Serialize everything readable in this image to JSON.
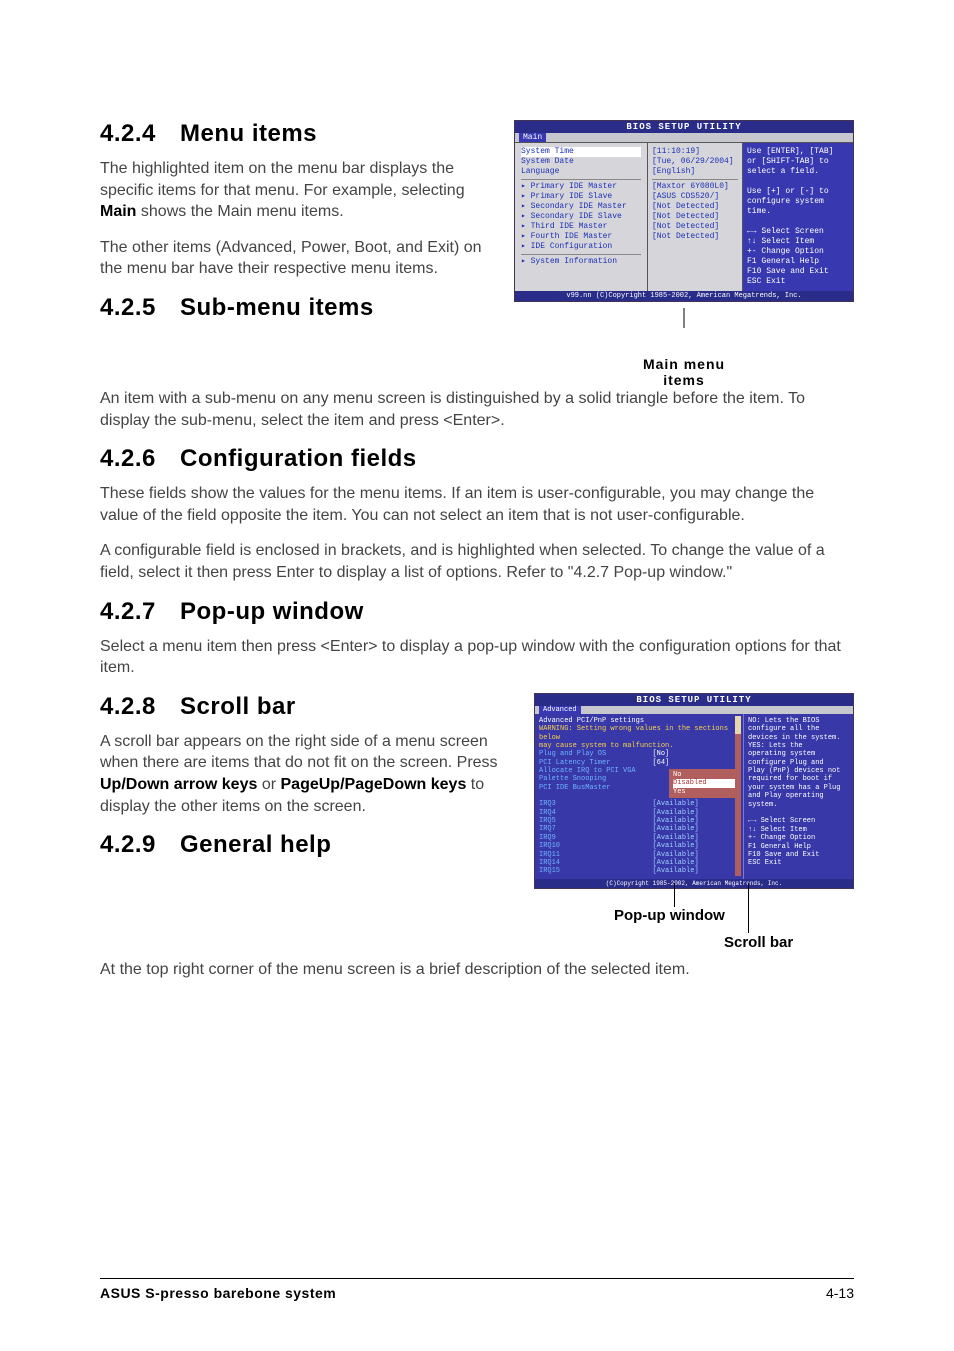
{
  "sections": {
    "s424": {
      "num": "4.2.4",
      "title": "Menu items",
      "p1": "The highlighted item on the menu bar  displays the specific items for that menu. For example, selecting ",
      "p1b": "Main",
      "p1c": " shows the Main menu items.",
      "p2": "The other items (Advanced, Power, Boot, and Exit) on the menu bar have their respective menu items."
    },
    "s425": {
      "num": "4.2.5",
      "title": "Sub-menu items",
      "p1": "An item with a sub-menu on any menu screen is distinguished by a solid triangle before the item. To display the sub-menu, select the item and press <Enter>."
    },
    "s426": {
      "num": "4.2.6",
      "title": "Configuration fields",
      "p1": "These fields show the values for the menu items. If an item is user-configurable, you may change the value of the field opposite the item. You can not select an item that is not user-configurable.",
      "p2": "A configurable field is enclosed in brackets, and is highlighted when selected. To change the value of a field, select it then press Enter to display a list of options. Refer to \"4.2.7 Pop-up window.\""
    },
    "s427": {
      "num": "4.2.7",
      "title": "Pop-up window",
      "p1": "Select a menu item then press <Enter> to display a pop-up window with the configuration options for that item."
    },
    "s428": {
      "num": "4.2.8",
      "title": "Scroll bar",
      "p1a": "A scroll bar appears on the right side of a menu screen when there are items that do not fit on the screen. Press ",
      "p1b": "Up/Down arrow keys",
      "p1c": " or ",
      "p1d": "PageUp/PageDown keys",
      "p1e": " to display the other items on the screen."
    },
    "s429": {
      "num": "4.2.9",
      "title": "General help",
      "p1": "At the top right corner of the menu screen is a brief description of the selected item."
    }
  },
  "bios1": {
    "title": "BIOS SETUP UTILITY",
    "tab": "Main",
    "left": {
      "l1": "System Time",
      "l2": "System Date",
      "l3": "Language",
      "l4": "▸ Primary IDE Master",
      "l5": "▸ Primary IDE Slave",
      "l6": "▸ Secondary IDE Master",
      "l7": "▸ Secondary IDE Slave",
      "l8": "▸ Third IDE Master",
      "l9": "▸ Fourth IDE Master",
      "l10": "▸ IDE Configuration",
      "l11": "▸ System Information"
    },
    "mid": {
      "m1": "[11:10:19]",
      "m2": "[Tue, 06/29/2004]",
      "m3": "[English]",
      "m4": "[Maxtor 6Y080L0]",
      "m5": "[ASUS CDS520/]",
      "m6": "[Not Detected]",
      "m7": "[Not Detected]",
      "m8": "[Not Detected]",
      "m9": "[Not Detected]"
    },
    "right": {
      "r1": "Use [ENTER], [TAB]",
      "r2": "or [SHIFT-TAB] to",
      "r3": "select a field.",
      "r4": "Use [+] or [-] to",
      "r5": "configure system",
      "r6": "time.",
      "r7": "←→   Select Screen",
      "r8": "↑↓   Select Item",
      "r9": "+-   Change Option",
      "r10": "F1   General Help",
      "r11": "F10  Save and Exit",
      "r12": "ESC  Exit"
    },
    "footer": "v99.nn (C)Copyright 1985-2002, American Megatrends, Inc.",
    "caption1": "Main menu",
    "caption2": "items"
  },
  "bios2": {
    "title": "BIOS SETUP UTILITY",
    "tab": "Advanced",
    "head": "Advanced PCI/PnP settings",
    "warn1": "WARNING: Setting wrong values in the sections below",
    "warn2": "         may cause system to malfunction.",
    "r1a": "Plug and Play OS",
    "r1b": "[No]",
    "r2a": "PCI Latency Timer",
    "r2b": "[64]",
    "r3a": "Allocate IRQ to PCI VGA",
    "r4a": "Palette Snooping",
    "r5a": "PCI IDE BusMaster",
    "popup1": "No",
    "popup2": "Yes",
    "popup_hl": "Disabled",
    "irq3": "IRQ3",
    "irq3v": "[Available]",
    "irq4": "IRQ4",
    "irq4v": "[Available]",
    "irq5": "IRQ5",
    "irq5v": "[Available]",
    "irq7": "IRQ7",
    "irq7v": "[Available]",
    "irq9": "IRQ9",
    "irq9v": "[Available]",
    "irq10": "IRQ10",
    "irq10v": "[Available]",
    "irq11": "IRQ11",
    "irq11v": "[Available]",
    "irq14": "IRQ14",
    "irq14v": "[Available]",
    "irq15": "IRQ15",
    "irq15v": "[Available]",
    "help1": "NO: Lets the BIOS",
    "help2": "configure all the",
    "help3": "devices in the system.",
    "help4": "YES: Lets the",
    "help5": "operating system",
    "help6": "configure Plug and",
    "help7": "Play (PnP) devices not",
    "help8": "required for boot if",
    "help9": "your system has a Plug",
    "help10": "and Play operating",
    "help11": "system.",
    "nav1": "←→   Select Screen",
    "nav2": "↑↓   Select Item",
    "nav3": "+-   Change Option",
    "nav4": "F1   General Help",
    "nav5": "F10  Save and Exit",
    "nav6": "ESC  Exit",
    "footer": "(C)Copyright 1985-2002, American Megatrends, Inc.",
    "lbl_popup": "Pop-up window",
    "lbl_scroll": "Scroll bar"
  },
  "pagefooter": {
    "left": "ASUS S-presso barebone system",
    "right": "4-13"
  }
}
